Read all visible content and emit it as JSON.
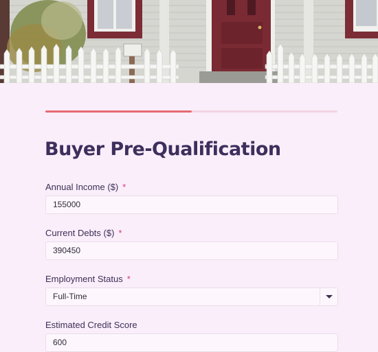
{
  "form": {
    "title": "Buyer Pre-Qualification",
    "progress": 0.5,
    "required_mark": "*",
    "fields": [
      {
        "label": "Annual Income ($)",
        "required": true,
        "value": "155000"
      },
      {
        "label": "Current Debts ($)",
        "required": true,
        "value": "390450"
      },
      {
        "label": "Employment Status",
        "required": true,
        "value": "Full-Time"
      },
      {
        "label": "Estimated Credit Score",
        "required": false,
        "value": "600"
      }
    ]
  },
  "colors": {
    "background": "#fbeefb",
    "accent": "#e46a72",
    "required": "#d63a7a",
    "title": "#3d2f5c"
  },
  "icons": {
    "select_caret": "caret-down-icon"
  }
}
